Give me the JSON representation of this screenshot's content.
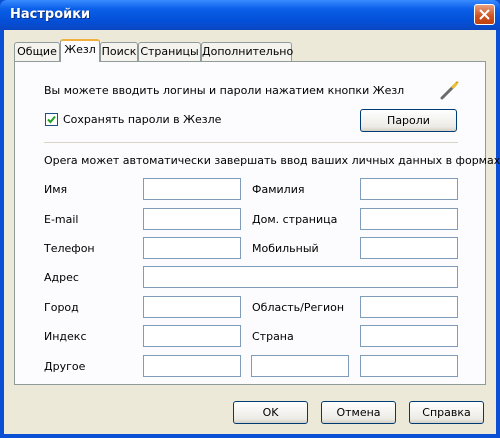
{
  "window": {
    "title": "Настройки"
  },
  "tabs": [
    {
      "label": "Общие"
    },
    {
      "label": "Жезл"
    },
    {
      "label": "Поиск"
    },
    {
      "label": "Страницы"
    },
    {
      "label": "Дополнительно"
    }
  ],
  "wand": {
    "intro": "Вы можете вводить логины и пароли нажатием кнопки Жезл",
    "save_passwords_label": "Сохранять пароли в Жезле",
    "save_passwords_checked": true,
    "passwords_button": "Пароли"
  },
  "personal": {
    "intro": "Opera может автоматически завершать ввод ваших личных данных в формах",
    "first_name": {
      "label": "Имя",
      "value": ""
    },
    "last_name": {
      "label": "Фамилия",
      "value": ""
    },
    "email": {
      "label": "E-mail",
      "value": ""
    },
    "homepage": {
      "label": "Дом. страница",
      "value": ""
    },
    "phone": {
      "label": "Телефон",
      "value": ""
    },
    "mobile": {
      "label": "Мобильный",
      "value": ""
    },
    "address": {
      "label": "Адрес",
      "value": ""
    },
    "city": {
      "label": "Город",
      "value": ""
    },
    "region": {
      "label": "Область/Регион",
      "value": ""
    },
    "zip": {
      "label": "Индекс",
      "value": ""
    },
    "country": {
      "label": "Страна",
      "value": ""
    },
    "other": {
      "label": "Другое",
      "value1": "",
      "value2": "",
      "value3": ""
    }
  },
  "footer": {
    "ok": "OK",
    "cancel": "Отмена",
    "help": "Справка"
  },
  "colors": {
    "title_bar": "#0a5fe8",
    "dialog_bg": "#ece9d8",
    "active_tab_accent": "#f2b03c"
  }
}
